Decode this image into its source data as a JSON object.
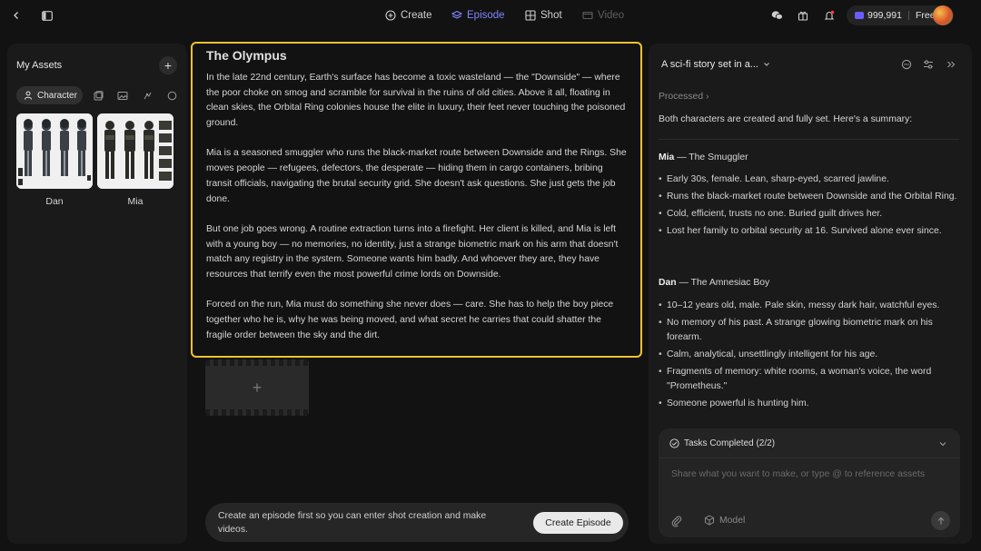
{
  "topbar": {
    "tabs": [
      {
        "label": "Create",
        "icon": "plus-circle-icon"
      },
      {
        "label": "Episode",
        "icon": "layers-icon"
      },
      {
        "label": "Shot",
        "icon": "grid-icon"
      },
      {
        "label": "Video",
        "icon": "video-icon"
      }
    ],
    "credits": "999,991",
    "plan": "Free"
  },
  "assets": {
    "title": "My Assets",
    "active_category": "Character",
    "items": [
      {
        "name": "Dan"
      },
      {
        "name": "Mia"
      }
    ]
  },
  "story": {
    "title": "The Olympus",
    "paragraphs": [
      "In the late 22nd century, Earth's surface has become a toxic wasteland — the \"Downside\" — where the poor choke on smog and scramble for survival in the ruins of old cities. Above it all, floating in clean skies, the Orbital Ring colonies house the elite in luxury, their feet never touching the poisoned ground.",
      "Mia is a seasoned smuggler who runs the black-market route between Downside and the Rings. She moves people — refugees, defectors, the desperate — hiding them in cargo containers, bribing transit officials, navigating the brutal security grid. She doesn't ask questions. She just gets the job done.",
      "But one job goes wrong. A routine extraction turns into a firefight. Her client is killed, and Mia is left with a young boy — no memories, no identity, just a strange biometric mark on his arm that doesn't match any registry in the system. Someone wants him badly. And whoever they are, they have resources that terrify even the most powerful crime lords on Downside.",
      "Forced on the run, Mia must do something she never does — care. She has to help the boy piece together who he is, why he was being moved, and what secret he carries that could shatter the fragile order between the sky and the dirt."
    ]
  },
  "notice": {
    "text": "Create an episode first so you can enter shot creation and make videos.",
    "button": "Create Episode"
  },
  "chat": {
    "title": "A sci-fi story set in a...",
    "processed": "Processed",
    "summary": "Both characters are created and fully set. Here's a summary:",
    "characters": [
      {
        "name": "Mia",
        "role": " — The Smuggler",
        "bullets": [
          "Early 30s, female. Lean, sharp-eyed, scarred jawline.",
          "Runs the black-market route between Downside and the Orbital Ring.",
          "Cold, efficient, trusts no one. Buried guilt drives her.",
          "Lost her family to orbital security at 16. Survived alone ever since."
        ]
      },
      {
        "name": "Dan",
        "role": " — The Amnesiac Boy",
        "bullets": [
          "10–12 years old, male. Pale skin, messy dark hair, watchful eyes.",
          "No memory of his past. A strange glowing biometric mark on his forearm.",
          "Calm, analytical, unsettlingly intelligent for his age.",
          "Fragments of memory: white rooms, a woman's voice, the word \"Prometheus.\"",
          "Someone powerful is hunting him."
        ]
      }
    ],
    "tasks": "Tasks Completed (2/2)",
    "input_placeholder": "Share what you want to make, or type @ to reference assets",
    "model_label": "Model"
  },
  "colors": {
    "accent": "#7f86ff",
    "highlight_border": "#f2c230",
    "background": "#121212",
    "panel": "#1a1a1a"
  }
}
